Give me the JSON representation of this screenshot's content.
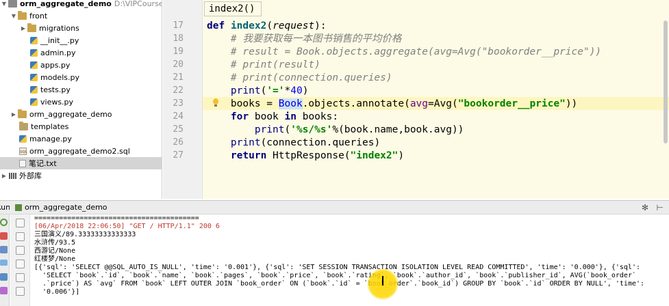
{
  "project_tree": {
    "items": [
      {
        "label": "orm_aggregate_demo",
        "extra": "D:\\VIPCourse\\cod",
        "kind": "project",
        "expanded": true,
        "bold": true
      },
      {
        "label": "front",
        "kind": "folder",
        "expanded": true
      },
      {
        "label": "migrations",
        "kind": "folder",
        "expanded": false
      },
      {
        "label": "__init__.py",
        "kind": "python"
      },
      {
        "label": "admin.py",
        "kind": "python"
      },
      {
        "label": "apps.py",
        "kind": "python"
      },
      {
        "label": "models.py",
        "kind": "python"
      },
      {
        "label": "tests.py",
        "kind": "python"
      },
      {
        "label": "views.py",
        "kind": "python"
      },
      {
        "label": "orm_aggregate_demo",
        "kind": "folder",
        "expanded": false
      },
      {
        "label": "templates",
        "kind": "folder-plain"
      },
      {
        "label": "manage.py",
        "kind": "python"
      },
      {
        "label": "orm_aggregate_demo2.sql",
        "kind": "sql"
      },
      {
        "label": "笔记.txt",
        "kind": "text",
        "selected": true
      },
      {
        "label": "外部库",
        "kind": "library",
        "expanded": false
      }
    ]
  },
  "editor": {
    "tooltip": "index2()",
    "current_line": "23",
    "lines": [
      {
        "num": "17",
        "text": "def index2(request):"
      },
      {
        "num": "18",
        "text": "    # 我要获取每一本图书销售的平均价格"
      },
      {
        "num": "19",
        "text": "    # result = Book.objects.aggregate(avg=Avg(\"bookorder__price\"))"
      },
      {
        "num": "20",
        "text": "    # print(result)"
      },
      {
        "num": "21",
        "text": "    # print(connection.queries)"
      },
      {
        "num": "22",
        "text": "    print('='*40)"
      },
      {
        "num": "23",
        "text": "    books = Book.objects.annotate(avg=Avg(\"bookorder__price\"))"
      },
      {
        "num": "24",
        "text": "    for book in books:"
      },
      {
        "num": "25",
        "text": "        print('%s/%s'%(book.name,book.avg))"
      },
      {
        "num": "26",
        "text": "    print(connection.queries)"
      },
      {
        "num": "27",
        "text": "    return HttpResponse(\"index2\")"
      }
    ]
  },
  "run_panel": {
    "title": "Run",
    "config_name": "orm_aggregate_demo",
    "console_lines": [
      "========================================",
      "[06/Apr/2018 22:06:50] \"GET / HTTP/1.1\" 200 6",
      "三国演义/89.33333333333333",
      "水浒传/93.5",
      "西游记/None",
      "红楼梦/None",
      "[{'sql': 'SELECT @@SQL_AUTO_IS_NULL', 'time': '0.001'}, {'sql': 'SET SESSION TRANSACTION ISOLATION LEVEL READ COMMITTED', 'time': '0.000'}, {'sql': ",
      "  'SELECT `book`.`id`, `book`.`name`, `book`.`pages`, `book`.`price`, `book`.`rating`, `book`.`author_id`, `book`.`publisher_id`, AVG(`book_order`",
      "  .`price`) AS `avg` FROM `book` LEFT OUTER JOIN `book_order` ON (`book`.`id` = `book_order`.`book_id`) GROUP BY `book`.`id` ORDER BY NULL', 'time': ",
      "  '0.006'}]"
    ]
  },
  "colors": {
    "editor_bg": "#fdfbe5",
    "keyword": "#000080",
    "string": "#008000",
    "comment": "#808080",
    "log_red": "#c0392b"
  }
}
